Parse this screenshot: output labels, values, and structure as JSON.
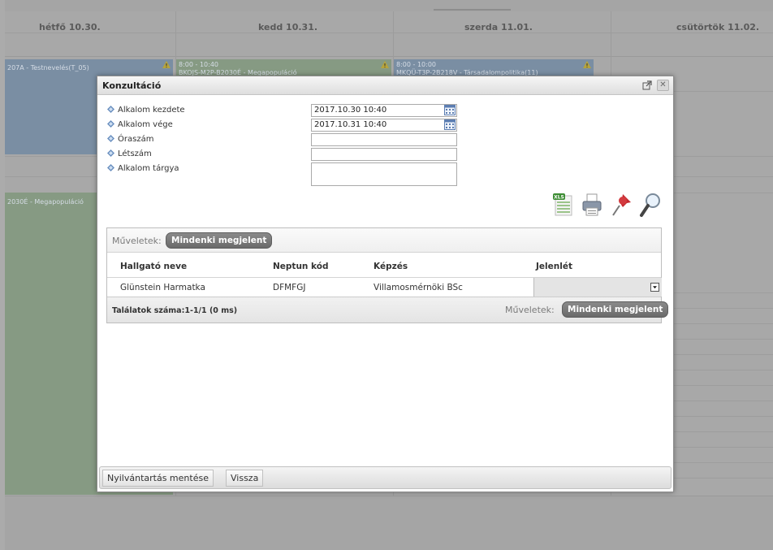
{
  "calendar": {
    "days": [
      "hétfő 10.30.",
      "kedd 10.31.",
      "szerda 11.01.",
      "csütörtök 11.02."
    ],
    "events": [
      {
        "time": "",
        "text": "207A - Testnevelés(T_05)"
      },
      {
        "time": "8:00 - 10:40",
        "text": "BKOJS-M2P-B2030É - Megapopuláció"
      },
      {
        "time": "8:00 - 10:00",
        "text": "MKQÜ-T3P-2B218V - Társadalompolitika(11)"
      },
      {
        "time": "",
        "text": "2030É - Megapopuláció"
      }
    ]
  },
  "modal": {
    "title": "Konzultáció",
    "form": {
      "start_label": "Alkalom kezdete",
      "start_value": "2017.10.30 10:40",
      "end_label": "Alkalom vége",
      "end_value": "2017.10.31 10:40",
      "hours_label": "Óraszám",
      "hours_value": "",
      "headcount_label": "Létszám",
      "headcount_value": "",
      "subject_label": "Alkalom tárgya",
      "subject_value": ""
    },
    "tools": {
      "xls": "XLS"
    },
    "grid": {
      "ops_label": "Műveletek:",
      "all_present_button": "Mindenki megjelent",
      "columns": [
        "Hallgató neve",
        "Neptun kód",
        "Képzés",
        "Jelenlét"
      ],
      "rows": [
        {
          "name": "Glünstein Harmatka",
          "neptun": "DFMFGJ",
          "program": "Villamosmérnöki BSc",
          "attendance": ""
        }
      ],
      "results": "Találatok száma:1-1/1 (0 ms)",
      "footer_ops_label": "Műveletek:",
      "footer_all_present_button": "Mindenki megjelent"
    },
    "buttons": {
      "save": "Nyilvántartás mentése",
      "back": "Vissza"
    }
  }
}
